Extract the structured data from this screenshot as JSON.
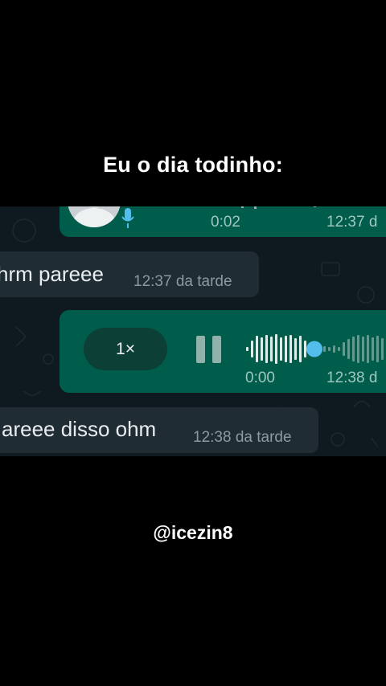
{
  "caption": {
    "top": "Eu o dia todinho:",
    "bottom": "@icezin8"
  },
  "chat": {
    "voice_top": {
      "duration": "0:02",
      "time": "12:37 d"
    },
    "incoming_1": {
      "text": "hrm pareee",
      "time": "12:37 da tarde"
    },
    "voice_playing": {
      "speed": "1×",
      "duration": "0:00",
      "time": "12:38 d"
    },
    "incoming_2": {
      "text": "areee disso ohm",
      "time": "12:38 da tarde"
    }
  },
  "icons": {
    "pause": "pause-icon",
    "mic": "mic-icon",
    "avatar": "avatar"
  },
  "colors": {
    "outgoing_bubble": "#005c4b",
    "incoming_bubble": "#1f2c34",
    "chat_background": "#0e1a20",
    "progress_dot": "#53bdeb"
  }
}
